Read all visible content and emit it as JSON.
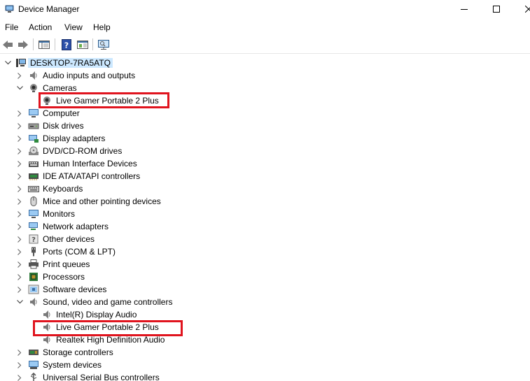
{
  "window": {
    "title": "Device Manager"
  },
  "menu": {
    "file": "File",
    "action": "Action",
    "view": "View",
    "help": "Help"
  },
  "tree": {
    "root": "DESKTOP-7RA5ATQ",
    "audio_inputs": "Audio inputs and outputs",
    "cameras": "Cameras",
    "camera_child": "Live Gamer Portable 2 Plus",
    "computer": "Computer",
    "disk_drives": "Disk drives",
    "display_adapters": "Display adapters",
    "dvd": "DVD/CD-ROM drives",
    "hid": "Human Interface Devices",
    "ide": "IDE ATA/ATAPI controllers",
    "keyboards": "Keyboards",
    "mice": "Mice and other pointing devices",
    "monitors": "Monitors",
    "network": "Network adapters",
    "other": "Other devices",
    "ports": "Ports (COM & LPT)",
    "print_queues": "Print queues",
    "processors": "Processors",
    "software_devices": "Software devices",
    "sound": "Sound, video and game controllers",
    "sound_intel": "Intel(R) Display Audio",
    "sound_lgp": "Live Gamer Portable 2 Plus",
    "sound_realtek": "Realtek High Definition Audio",
    "storage": "Storage controllers",
    "system": "System devices",
    "usb": "Universal Serial Bus controllers"
  },
  "colors": {
    "highlight_box": "#e0141e",
    "selection": "#cce8ff"
  }
}
